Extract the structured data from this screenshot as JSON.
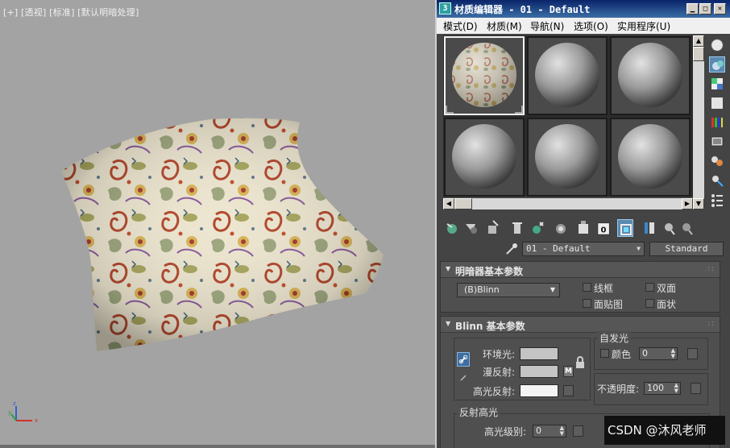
{
  "viewport": {
    "label": "[+] [透视] [标准] [默认明暗处理]",
    "gizmo_axes": {
      "x": "x",
      "y": "y",
      "z": "z"
    }
  },
  "material_editor": {
    "app_icon_text": "3",
    "title": "材质编辑器 - 01 - Default",
    "window_buttons": {
      "minimize": "▁",
      "maximize": "□",
      "close": "✕"
    },
    "menu": [
      {
        "label": "模式(D)"
      },
      {
        "label": "材质(M)"
      },
      {
        "label": "导航(N)"
      },
      {
        "label": "选项(O)"
      },
      {
        "label": "实用程序(U)"
      }
    ],
    "sample_slots": [
      {
        "id": 1,
        "kind": "paisley",
        "active": true
      },
      {
        "id": 2,
        "kind": "default",
        "active": false
      },
      {
        "id": 3,
        "kind": "default",
        "active": false
      },
      {
        "id": 4,
        "kind": "default",
        "active": false
      },
      {
        "id": 5,
        "kind": "default",
        "active": false
      },
      {
        "id": 6,
        "kind": "default",
        "active": false
      }
    ],
    "side_tools": [
      "sample-type-icon",
      "backlight-icon",
      "background-checker-icon",
      "sample-uv-tiling-icon",
      "video-color-check-icon",
      "make-preview-icon",
      "options-icon",
      "select-by-material-icon",
      "material-map-navigator-icon"
    ],
    "bottom_tools": [
      "get-material-icon",
      "put-to-scene-icon",
      "assign-to-selection-icon",
      "delete-icon",
      "make-unique-icon",
      "put-to-library-icon",
      "material-id-channel-icon",
      "show-map-in-viewport-icon",
      "show-end-result-icon",
      "go-to-parent-icon",
      "go-forward-sibling-icon"
    ],
    "material_id_value": "0",
    "material_name": "01 - Default",
    "material_type": "Standard",
    "shader_rollout": {
      "title": "明暗器基本参数",
      "shader": "(B)Blinn",
      "options": [
        {
          "label": "线框"
        },
        {
          "label": "双面"
        },
        {
          "label": "面贴图"
        },
        {
          "label": "面状"
        }
      ]
    },
    "blinn_rollout": {
      "title": "Blinn 基本参数",
      "self_illum_group": "自发光",
      "color_label": "颜色",
      "color_value": "0",
      "ambient_label": "环境光:",
      "diffuse_label": "漫反射:",
      "specular_label": "高光反射:",
      "diffuse_map_letter": "M",
      "opacity_label": "不透明度:",
      "opacity_value": "100",
      "specular_group": "反射高光",
      "spec_level_label": "高光级别:",
      "spec_level_value": "0",
      "colors": {
        "ambient": "#c4c4c4",
        "diffuse": "#c4c4c4",
        "specular": "#f4f4f4"
      }
    }
  },
  "watermark": "CSDN @沐风老师",
  "colors": {
    "viewport_bg": "#a3a3a3",
    "panel_bg": "#444444",
    "title_blue": "#0a246a",
    "active_tool": "#5a8ab0"
  }
}
